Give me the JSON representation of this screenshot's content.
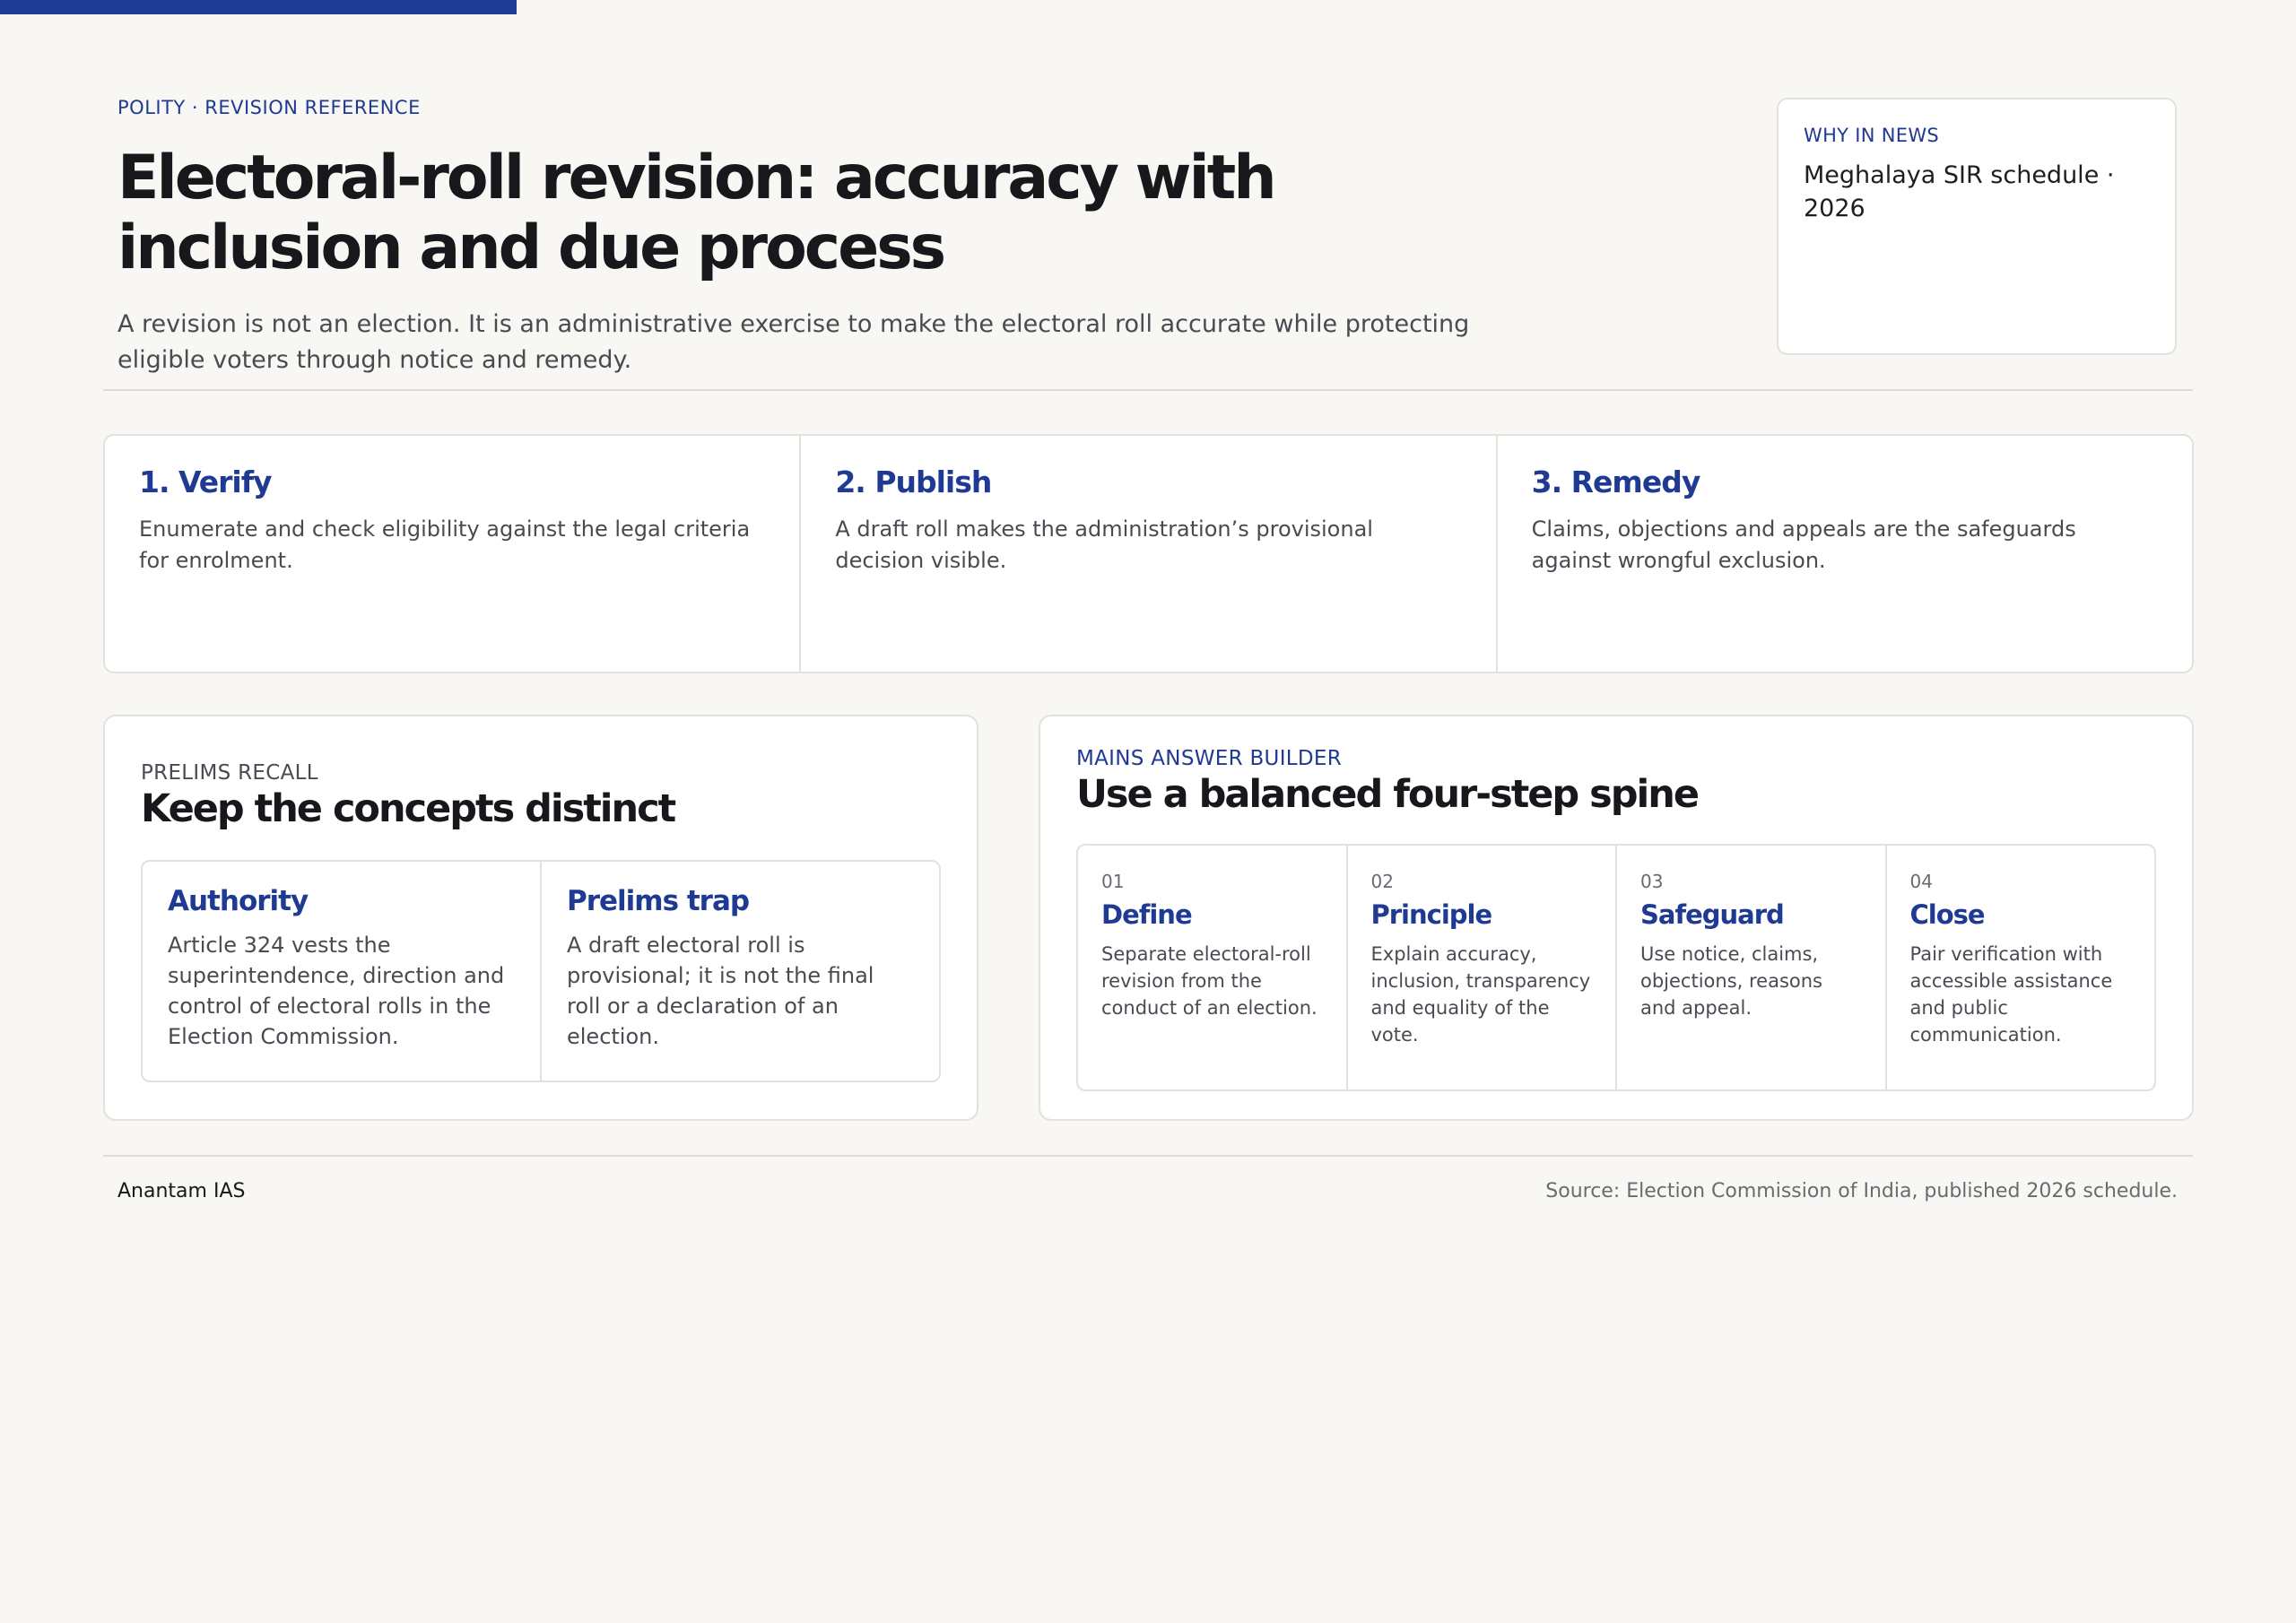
{
  "header": {
    "eyebrow": "POLITY · REVISION REFERENCE",
    "title": "Electoral-roll revision: accuracy with inclusion and due process",
    "subtitle": "A revision is not an election. It is an administrative exercise to make the electoral roll accurate while protecting eligible voters through notice and remedy."
  },
  "news": {
    "label": "WHY IN NEWS",
    "text": "Meghalaya SIR schedule · 2026"
  },
  "steps": [
    {
      "title": "1. Verify",
      "text": "Enumerate and check eligibility against the legal criteria for enrolment."
    },
    {
      "title": "2. Publish",
      "text": "A draft roll makes the administration’s provisional decision visible."
    },
    {
      "title": "3. Remedy",
      "text": "Claims, objections and appeals are the safeguards against wrongful exclusion."
    }
  ],
  "prelims": {
    "eyebrow": "PRELIMS RECALL",
    "title": "Keep the concepts distinct",
    "cells": [
      {
        "title": "Authority",
        "text": "Article 324 vests the superintendence, direction and control of electoral rolls in the Election Commission."
      },
      {
        "title": "Prelims trap",
        "text": "A draft electoral roll is provisional; it is not the final roll or a declaration of an election."
      }
    ]
  },
  "mains": {
    "eyebrow": "MAINS ANSWER BUILDER",
    "title": "Use a balanced four-step spine",
    "cells": [
      {
        "num": "01",
        "title": "Define",
        "text": "Separate electoral-roll revision from the conduct of an election."
      },
      {
        "num": "02",
        "title": "Principle",
        "text": "Explain accuracy, inclusion, transparency and equality of the vote."
      },
      {
        "num": "03",
        "title": "Safeguard",
        "text": "Use notice, claims, objections, reasons and appeal."
      },
      {
        "num": "04",
        "title": "Close",
        "text": "Pair verification with accessible assistance and public communication."
      }
    ]
  },
  "footer": {
    "brand": "Anantam IAS",
    "source": "Source: Election Commission of India, published 2026 schedule."
  },
  "colors": {
    "accent": "#1f3a93",
    "background": "#f8f7f3"
  }
}
